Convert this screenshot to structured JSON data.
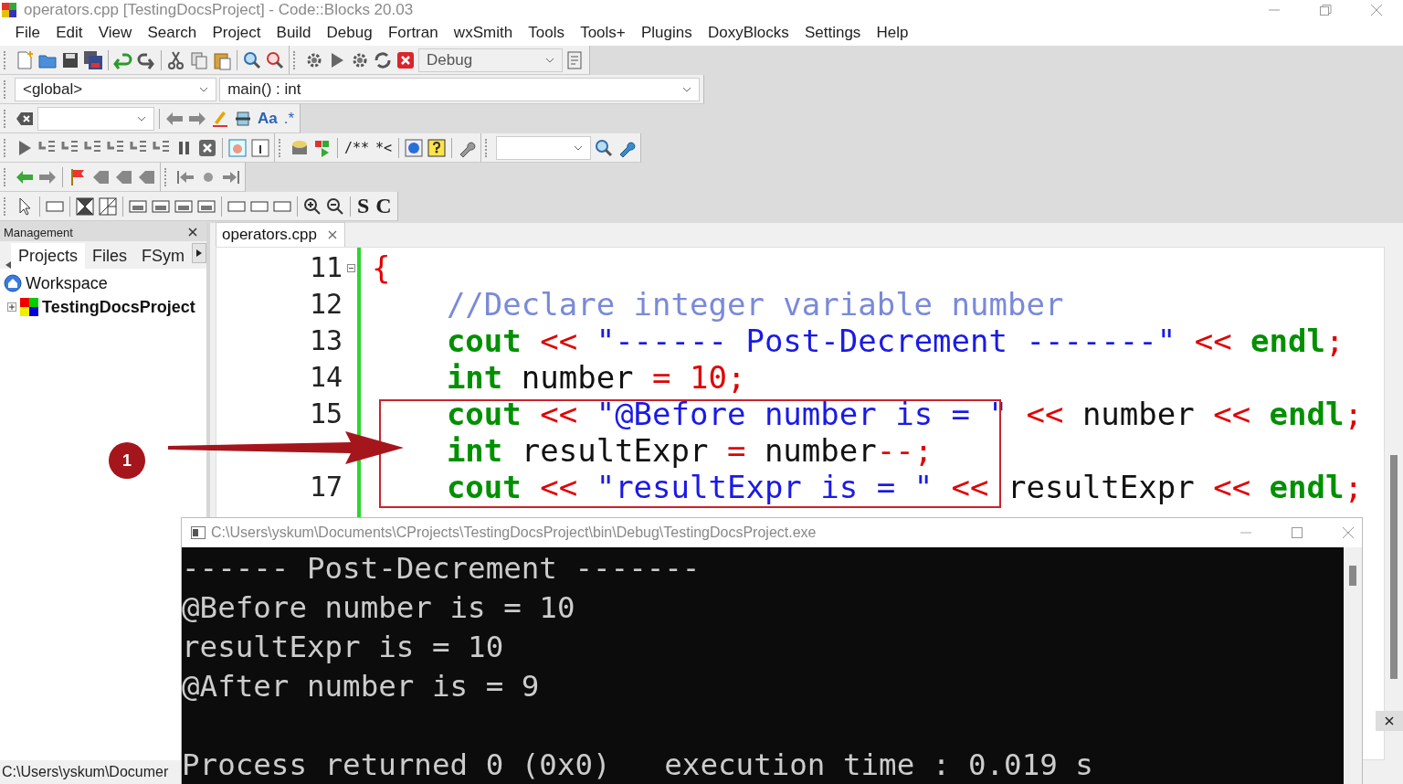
{
  "window": {
    "title": "operators.cpp [TestingDocsProject] - Code::Blocks 20.03"
  },
  "menu": [
    "File",
    "Edit",
    "View",
    "Search",
    "Project",
    "Build",
    "Debug",
    "Fortran",
    "wxSmith",
    "Tools",
    "Tools+",
    "Plugins",
    "DoxyBlocks",
    "Settings",
    "Help"
  ],
  "toolbar": {
    "build_target": "Debug",
    "scope": "<global>",
    "function": "main() : int",
    "search_labels": [
      "Aa",
      ".*"
    ],
    "doxy_labels": [
      "/**",
      "*<"
    ],
    "wx_labels": [
      "S",
      "C"
    ]
  },
  "management": {
    "title": "Management",
    "tabs": [
      {
        "label": "Projects",
        "selected": true
      },
      {
        "label": "Files",
        "selected": false
      },
      {
        "label": "FSym",
        "selected": false
      }
    ],
    "tree": [
      {
        "label": "Workspace",
        "kind": "workspace",
        "children": [
          {
            "label": "TestingDocsProject",
            "kind": "project",
            "expanded": false
          }
        ]
      }
    ]
  },
  "editor": {
    "tab": "operators.cpp",
    "lines": [
      {
        "number": "11",
        "fold": true,
        "tokens": [
          {
            "kind": "brace",
            "text": "{"
          }
        ]
      },
      {
        "number": "12",
        "fold": false,
        "tokens": [
          {
            "kind": "comment",
            "text": "    //Declare integer variable number"
          }
        ]
      },
      {
        "number": "13",
        "fold": false,
        "tokens": [
          {
            "kind": "keyword",
            "text": "    cout"
          },
          {
            "kind": "op",
            "text": " << "
          },
          {
            "kind": "string",
            "text": "\"------ Post-Decrement -------\""
          },
          {
            "kind": "op",
            "text": " << "
          },
          {
            "kind": "keyword",
            "text": "endl"
          },
          {
            "kind": "op",
            "text": ";"
          }
        ]
      },
      {
        "number": "14",
        "fold": false,
        "tokens": [
          {
            "kind": "keyword",
            "text": "    int"
          },
          {
            "kind": "plain",
            "text": " number "
          },
          {
            "kind": "op",
            "text": "= 10;"
          }
        ]
      },
      {
        "number": "15",
        "fold": false,
        "tokens": [
          {
            "kind": "keyword",
            "text": "    cout"
          },
          {
            "kind": "op",
            "text": " << "
          },
          {
            "kind": "string",
            "text": "\"@Before number is = \""
          },
          {
            "kind": "op",
            "text": " << "
          },
          {
            "kind": "plain",
            "text": "number"
          },
          {
            "kind": "op",
            "text": " << "
          },
          {
            "kind": "keyword",
            "text": "endl"
          },
          {
            "kind": "op",
            "text": ";"
          }
        ]
      },
      {
        "fold": false,
        "tokens": [
          {
            "kind": "keyword",
            "text": "    int"
          },
          {
            "kind": "plain",
            "text": " resultExpr "
          },
          {
            "kind": "op",
            "text": "="
          },
          {
            "kind": "plain",
            "text": " number"
          },
          {
            "kind": "op",
            "text": "--;"
          }
        ]
      },
      {
        "number": "17",
        "fold": false,
        "tokens": [
          {
            "kind": "keyword",
            "text": "    cout"
          },
          {
            "kind": "op",
            "text": " << "
          },
          {
            "kind": "string",
            "text": "\"resultExpr is = \""
          },
          {
            "kind": "op",
            "text": " <<"
          },
          {
            "kind": "plain",
            "text": " resultExpr"
          },
          {
            "kind": "op",
            "text": " << "
          },
          {
            "kind": "keyword",
            "text": "endl"
          },
          {
            "kind": "op",
            "text": ";"
          }
        ]
      }
    ]
  },
  "annotation": {
    "badge": "1"
  },
  "console": {
    "title": "C:\\Users\\yskum\\Documents\\CProjects\\TestingDocsProject\\bin\\Debug\\TestingDocsProject.exe",
    "lines": [
      "------ Post-Decrement -------",
      "@Before number is = 10",
      "resultExpr is = 10",
      "@After number is = 9"
    ],
    "summary": "Process returned 0 (0x0)   execution time : 0.019 s"
  },
  "status_bar": {
    "path": "C:\\Users\\yskum\\Documer"
  }
}
